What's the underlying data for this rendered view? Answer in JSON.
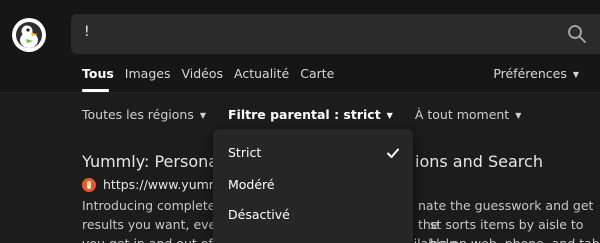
{
  "search": {
    "query": "!"
  },
  "tabs": [
    {
      "label": "Tous",
      "active": true
    },
    {
      "label": "Images"
    },
    {
      "label": "Vidéos"
    },
    {
      "label": "Actualité"
    },
    {
      "label": "Carte"
    }
  ],
  "preferences_label": "Préférences",
  "filters": {
    "region": "Toutes les régions",
    "safe_search": "Filtre parental : strict",
    "time": "À tout moment"
  },
  "dropdown": {
    "items": [
      "Strict",
      "Modéré",
      "Désactivé"
    ],
    "selected": "Strict"
  },
  "result": {
    "title": "Yummly: Personal",
    "title_end": "ions and Search",
    "url": "https://www.yummly",
    "snippet_line1_left": "Introducing completely",
    "snippet_line1_right": "nate the guesswork and get the",
    "snippet_line2_left": "results you want, every",
    "snippet_line2_right": "st sorts items by aisle to help",
    "snippet_line3": "you get in and out of the grocery store fast. Now available on web, phone, and tablet"
  },
  "icons": {
    "logo": "duckduckgo-logo",
    "search": "search-icon",
    "check": "check-icon",
    "caret": "caret-down-icon"
  },
  "colors": {
    "background": "#1c1c1c",
    "header": "#161616",
    "searchbox": "#2b2b2b",
    "dropdown": "#262626",
    "favicon": "#e75a2a"
  }
}
